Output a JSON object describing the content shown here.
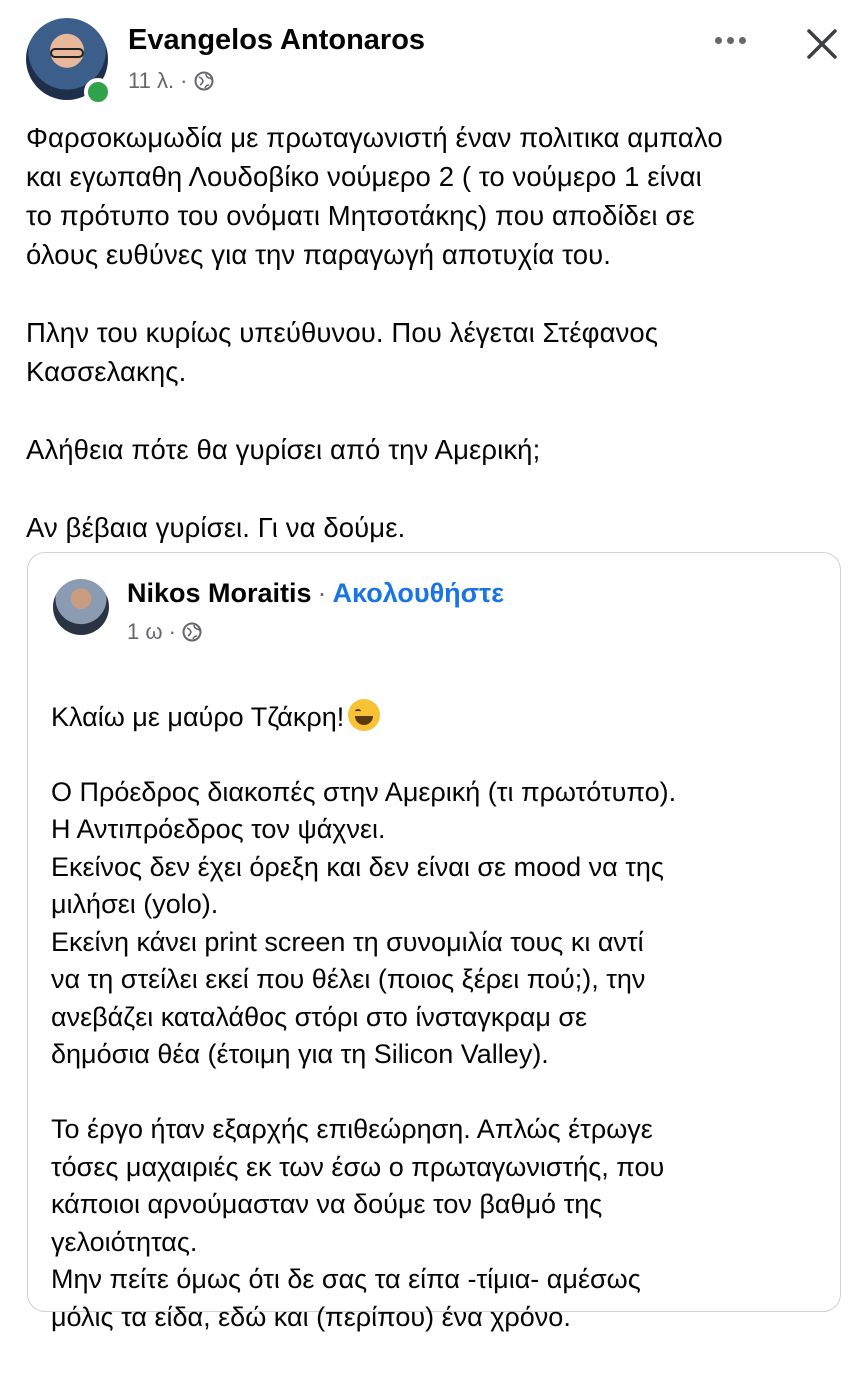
{
  "post": {
    "author": "Evangelos Antonaros",
    "time": "11 λ. ·",
    "text": "Φαρσοκωμωδία με πρωταγωνιστή έναν πολιτικα αμπαλο\nκαι εγωπαθη Λουδοβίκο νούμερο 2 ( το νούμερο 1 είναι\nτο πρότυπο του ονόματι Μητσοτάκης) που αποδίδει σε\nόλους ευθύνες για την παραγωγή αποτυχία του.\n\nΠλην του κυρίως υπεύθυνου. Που λέγεται Στέφανος\nΚασσελακης.\n\nΑλήθεια πότε θα γυρίσει από την Αμερική;\n\nΑν βέβαια γυρίσει. Γι να δούμε."
  },
  "shared": {
    "author": "Nikos Moraitis",
    "separator": "·",
    "follow_label": "Ακολουθήστε",
    "time": "1 ω ·",
    "first_line": "Κλαίω με μαύρο Τζάκρη!",
    "body": "Ο Πρόεδρος διακοπές στην Αμερική (τι πρωτότυπο).\nΗ Αντιπρόεδρος τον ψάχνει.\nΕκείνος δεν έχει όρεξη και δεν είναι σε mood να της\nμιλήσει (yolo).\nΕκείνη κάνει print screen τη συνομιλία τους κι αντί\nνα τη στείλει εκεί που θέλει (ποιος ξέρει πού;), την\nανεβάζει καταλάθος στόρι στο ίνσταγκραμ σε\nδημόσια θέα (έτοιμη για τη Silicon Valley).\n\nΤο έργο ήταν εξαρχής επιθεώρηση. Απλώς έτρωγε\nτόσες μαχαιριές εκ των έσω ο πρωταγωνιστής, που\nκάποιοι αρνούμασταν να δούμε τον βαθμό της\nγελοιότητας.\nΜην πείτε όμως ότι δε σας τα είπα -τίμια- αμέσως\nμόλις τα είδα, εδώ και (περίπου) ένα χρόνο."
  },
  "icons": {
    "globe": "globe-icon",
    "more": "more-options-icon",
    "close": "close-icon",
    "emoji": "laughing-tears-emoji"
  },
  "colors": {
    "online": "#31a24c",
    "follow": "#1b74e4",
    "meta": "#65676b"
  }
}
